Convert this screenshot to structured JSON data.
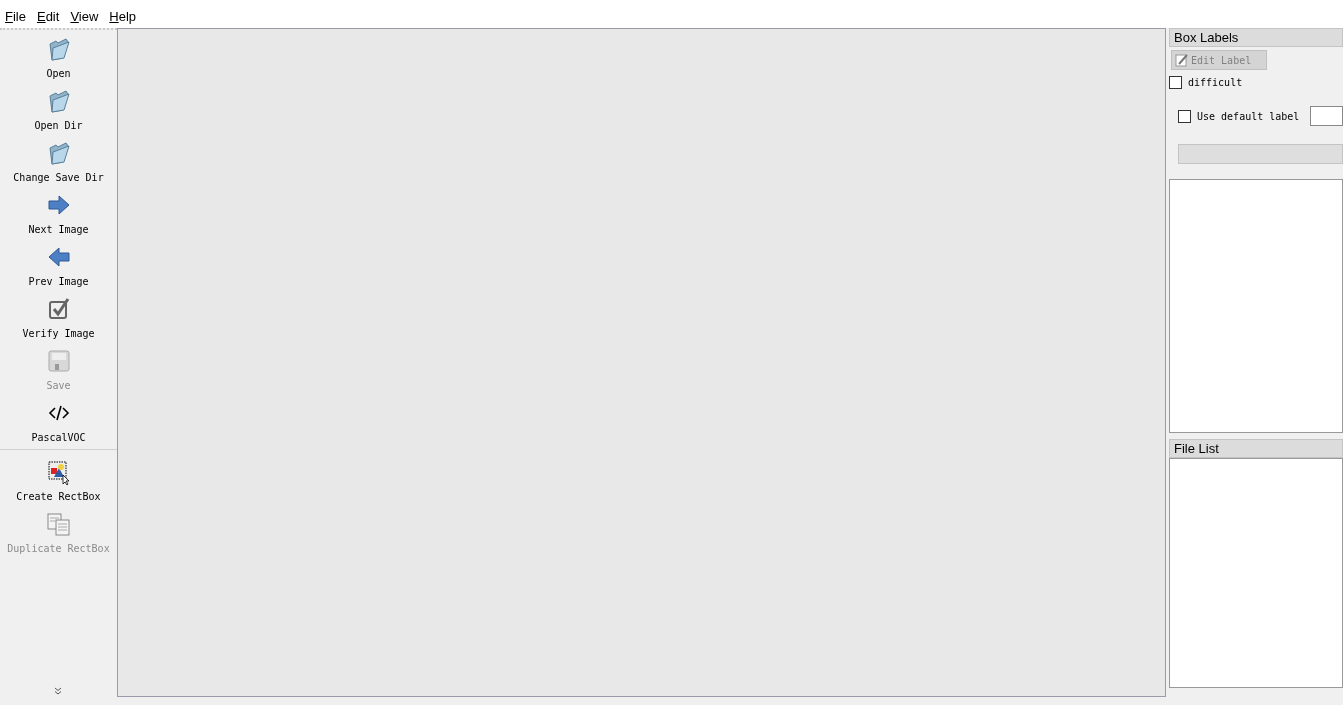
{
  "menu": [
    {
      "label": "File"
    },
    {
      "label": "Edit"
    },
    {
      "label": "View"
    },
    {
      "label": "Help"
    }
  ],
  "toolbar_groups": [
    [
      {
        "label": "Open",
        "kind": "folder",
        "disabled": false
      },
      {
        "label": "Open Dir",
        "kind": "folder",
        "disabled": false
      },
      {
        "label": "Change Save Dir",
        "kind": "folder",
        "disabled": false
      },
      {
        "label": "Next Image",
        "kind": "arrow-right",
        "disabled": false
      },
      {
        "label": "Prev Image",
        "kind": "arrow-left",
        "disabled": false
      },
      {
        "label": "Verify Image",
        "kind": "check",
        "disabled": false
      },
      {
        "label": "Save",
        "kind": "save",
        "disabled": true
      },
      {
        "label": "PascalVOC",
        "kind": "code",
        "disabled": false
      }
    ],
    [
      {
        "label": "Create RectBox",
        "kind": "rectbox",
        "disabled": false
      },
      {
        "label": "Duplicate RectBox",
        "kind": "duplicate",
        "disabled": true
      }
    ]
  ],
  "box_labels": {
    "title": "Box Labels",
    "edit_button": {
      "label": "Edit Label",
      "disabled": true
    },
    "difficult": {
      "label": "difficult",
      "checked": false
    },
    "use_default": {
      "label": "Use default label",
      "checked": false
    }
  },
  "file_list": {
    "title": "File List"
  }
}
